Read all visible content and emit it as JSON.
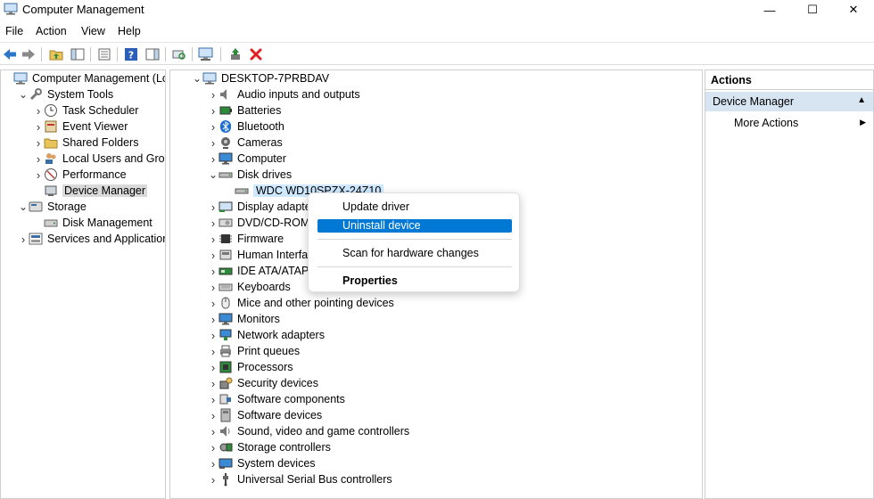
{
  "window": {
    "title": "Computer Management",
    "controls": {
      "minimize": "—",
      "maximize": "☐",
      "close": "✕"
    }
  },
  "menu": [
    "File",
    "Action",
    "View",
    "Help"
  ],
  "toolbar": {
    "buttons": [
      "back",
      "forward",
      "up-folder",
      "show-hide-tree",
      "properties",
      "help",
      "show-hide-action-pane",
      "scan-hardware",
      "update-driver",
      "enable-device",
      "uninstall-device"
    ]
  },
  "left_tree": [
    {
      "label": "Computer Management (Local",
      "level": 0,
      "chev": "",
      "icon": "computer"
    },
    {
      "label": "System Tools",
      "level": 1,
      "chev": "⌄",
      "icon": "tools"
    },
    {
      "label": "Task Scheduler",
      "level": 2,
      "chev": "›",
      "icon": "clock"
    },
    {
      "label": "Event Viewer",
      "level": 2,
      "chev": "›",
      "icon": "event"
    },
    {
      "label": "Shared Folders",
      "level": 2,
      "chev": "›",
      "icon": "folder"
    },
    {
      "label": "Local Users and Groups",
      "level": 2,
      "chev": "›",
      "icon": "users"
    },
    {
      "label": "Performance",
      "level": 2,
      "chev": "›",
      "icon": "perf"
    },
    {
      "label": "Device Manager",
      "level": 2,
      "chev": "",
      "icon": "devmgr",
      "selected": true
    },
    {
      "label": "Storage",
      "level": 1,
      "chev": "⌄",
      "icon": "storage"
    },
    {
      "label": "Disk Management",
      "level": 2,
      "chev": "",
      "icon": "disk"
    },
    {
      "label": "Services and Applications",
      "level": 1,
      "chev": "›",
      "icon": "services"
    }
  ],
  "device_tree": [
    {
      "label": "DESKTOP-7PRBDAV",
      "level": 0,
      "chev": "⌄",
      "icon": "computer"
    },
    {
      "label": "Audio inputs and outputs",
      "level": 1,
      "chev": "›",
      "icon": "audio"
    },
    {
      "label": "Batteries",
      "level": 1,
      "chev": "›",
      "icon": "battery"
    },
    {
      "label": "Bluetooth",
      "level": 1,
      "chev": "›",
      "icon": "bluetooth"
    },
    {
      "label": "Cameras",
      "level": 1,
      "chev": "›",
      "icon": "camera"
    },
    {
      "label": "Computer",
      "level": 1,
      "chev": "›",
      "icon": "monitor"
    },
    {
      "label": "Disk drives",
      "level": 1,
      "chev": "⌄",
      "icon": "drive"
    },
    {
      "label": "WDC WD10SPZX-24Z10",
      "level": 2,
      "chev": "",
      "icon": "drive",
      "selected": true
    },
    {
      "label": "Display adapters",
      "level": 1,
      "chev": "›",
      "icon": "display"
    },
    {
      "label": "DVD/CD-ROM dri",
      "level": 1,
      "chev": "›",
      "icon": "dvd"
    },
    {
      "label": "Firmware",
      "level": 1,
      "chev": "›",
      "icon": "firmware"
    },
    {
      "label": "Human Interface",
      "level": 1,
      "chev": "›",
      "icon": "hid"
    },
    {
      "label": "IDE ATA/ATAPI co",
      "level": 1,
      "chev": "›",
      "icon": "ide"
    },
    {
      "label": "Keyboards",
      "level": 1,
      "chev": "›",
      "icon": "keyboard"
    },
    {
      "label": "Mice and other pointing devices",
      "level": 1,
      "chev": "›",
      "icon": "mouse"
    },
    {
      "label": "Monitors",
      "level": 1,
      "chev": "›",
      "icon": "monitor"
    },
    {
      "label": "Network adapters",
      "level": 1,
      "chev": "›",
      "icon": "network"
    },
    {
      "label": "Print queues",
      "level": 1,
      "chev": "›",
      "icon": "printer"
    },
    {
      "label": "Processors",
      "level": 1,
      "chev": "›",
      "icon": "cpu"
    },
    {
      "label": "Security devices",
      "level": 1,
      "chev": "›",
      "icon": "security"
    },
    {
      "label": "Software components",
      "level": 1,
      "chev": "›",
      "icon": "component"
    },
    {
      "label": "Software devices",
      "level": 1,
      "chev": "›",
      "icon": "softdev"
    },
    {
      "label": "Sound, video and game controllers",
      "level": 1,
      "chev": "›",
      "icon": "sound"
    },
    {
      "label": "Storage controllers",
      "level": 1,
      "chev": "›",
      "icon": "storagectl"
    },
    {
      "label": "System devices",
      "level": 1,
      "chev": "›",
      "icon": "sysdev"
    },
    {
      "label": "Universal Serial Bus controllers",
      "level": 1,
      "chev": "›",
      "icon": "usb"
    }
  ],
  "context_menu": {
    "items": [
      {
        "label": "Update driver",
        "bold": false,
        "highlighted": false
      },
      {
        "label": "Uninstall device",
        "bold": false,
        "highlighted": true
      },
      {
        "label": "Scan for hardware changes",
        "bold": false,
        "highlighted": false
      },
      {
        "label": "Properties",
        "bold": true,
        "highlighted": false
      }
    ]
  },
  "actions_pane": {
    "heading": "Actions",
    "section": "Device Manager",
    "items": [
      {
        "label": "More Actions",
        "arrow": "▶"
      }
    ],
    "collapse_arrow": "▲"
  },
  "colors": {
    "accent": "#0078d4",
    "selection": "#cde8ff",
    "section_bg": "#d7e4f2",
    "close_x": "#e02020"
  }
}
